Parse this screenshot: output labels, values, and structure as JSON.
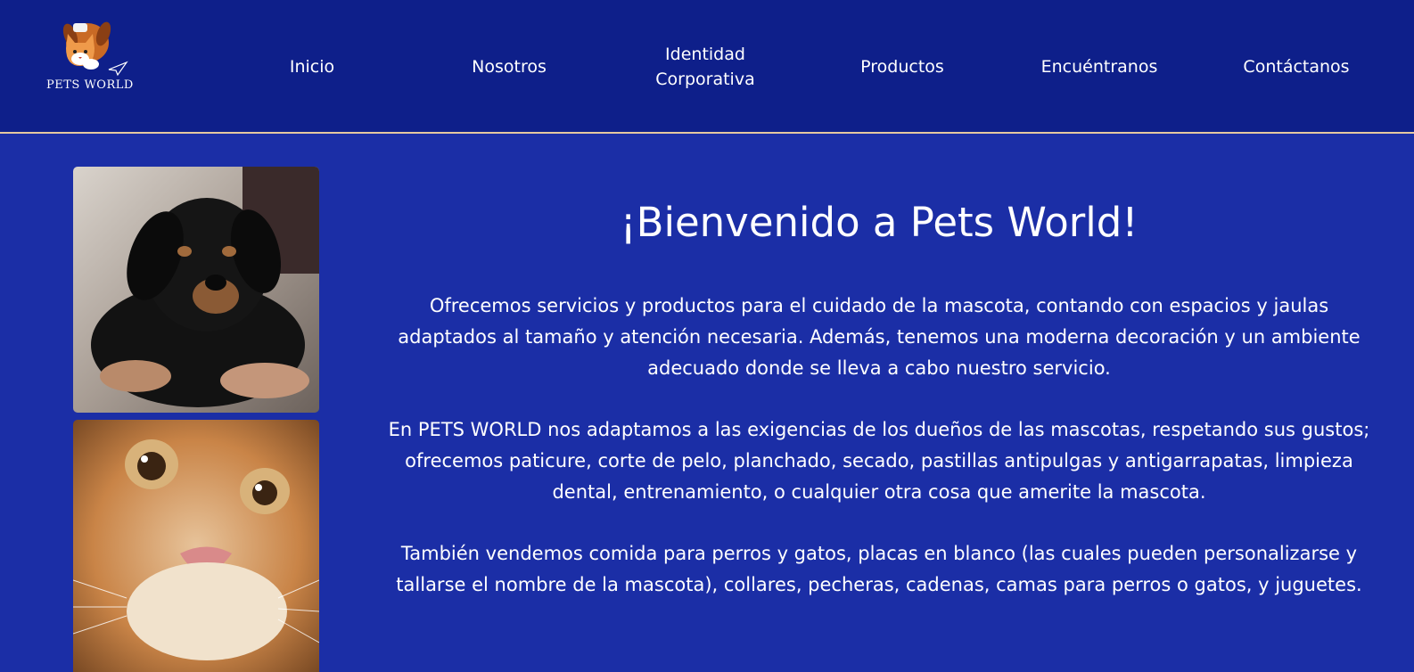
{
  "brand": {
    "logo_text": "PETS WORLD",
    "colors": {
      "header_bg": "#0e1f8a",
      "body_bg": "#1b2ea6",
      "divider": "#e4c8a0",
      "logo_orange": "#e88a3a"
    }
  },
  "nav": {
    "items": [
      {
        "label": "Inicio"
      },
      {
        "label": "Nosotros"
      },
      {
        "label": "Identidad Corporativa"
      },
      {
        "label": "Productos"
      },
      {
        "label": "Encuéntranos"
      },
      {
        "label": "Contáctanos"
      }
    ]
  },
  "gallery": {
    "images": [
      {
        "icon": "puppy-photo"
      },
      {
        "icon": "kitten-photo"
      }
    ]
  },
  "main": {
    "title": "¡Bienvenido a Pets World!",
    "paragraphs": [
      "Ofrecemos servicios y productos para el cuidado de la mascota, contando con espacios y jaulas adaptados al tamaño y atención necesaria. Además, tenemos una moderna decoración y un ambiente adecuado donde se lleva a cabo nuestro servicio.",
      "En PETS WORLD nos adaptamos a las exigencias de los dueños de las mascotas, respetando sus gustos; ofrecemos paticure, corte de pelo, planchado, secado, pastillas antipulgas y antigarrapatas, limpieza dental, entrenamiento, o cualquier otra cosa que amerite la mascota.",
      "También vendemos comida para perros y gatos, placas en blanco (las cuales pueden personalizarse y tallarse el nombre de la mascota), collares, pecheras, cadenas, camas para perros o gatos, y juguetes."
    ]
  }
}
